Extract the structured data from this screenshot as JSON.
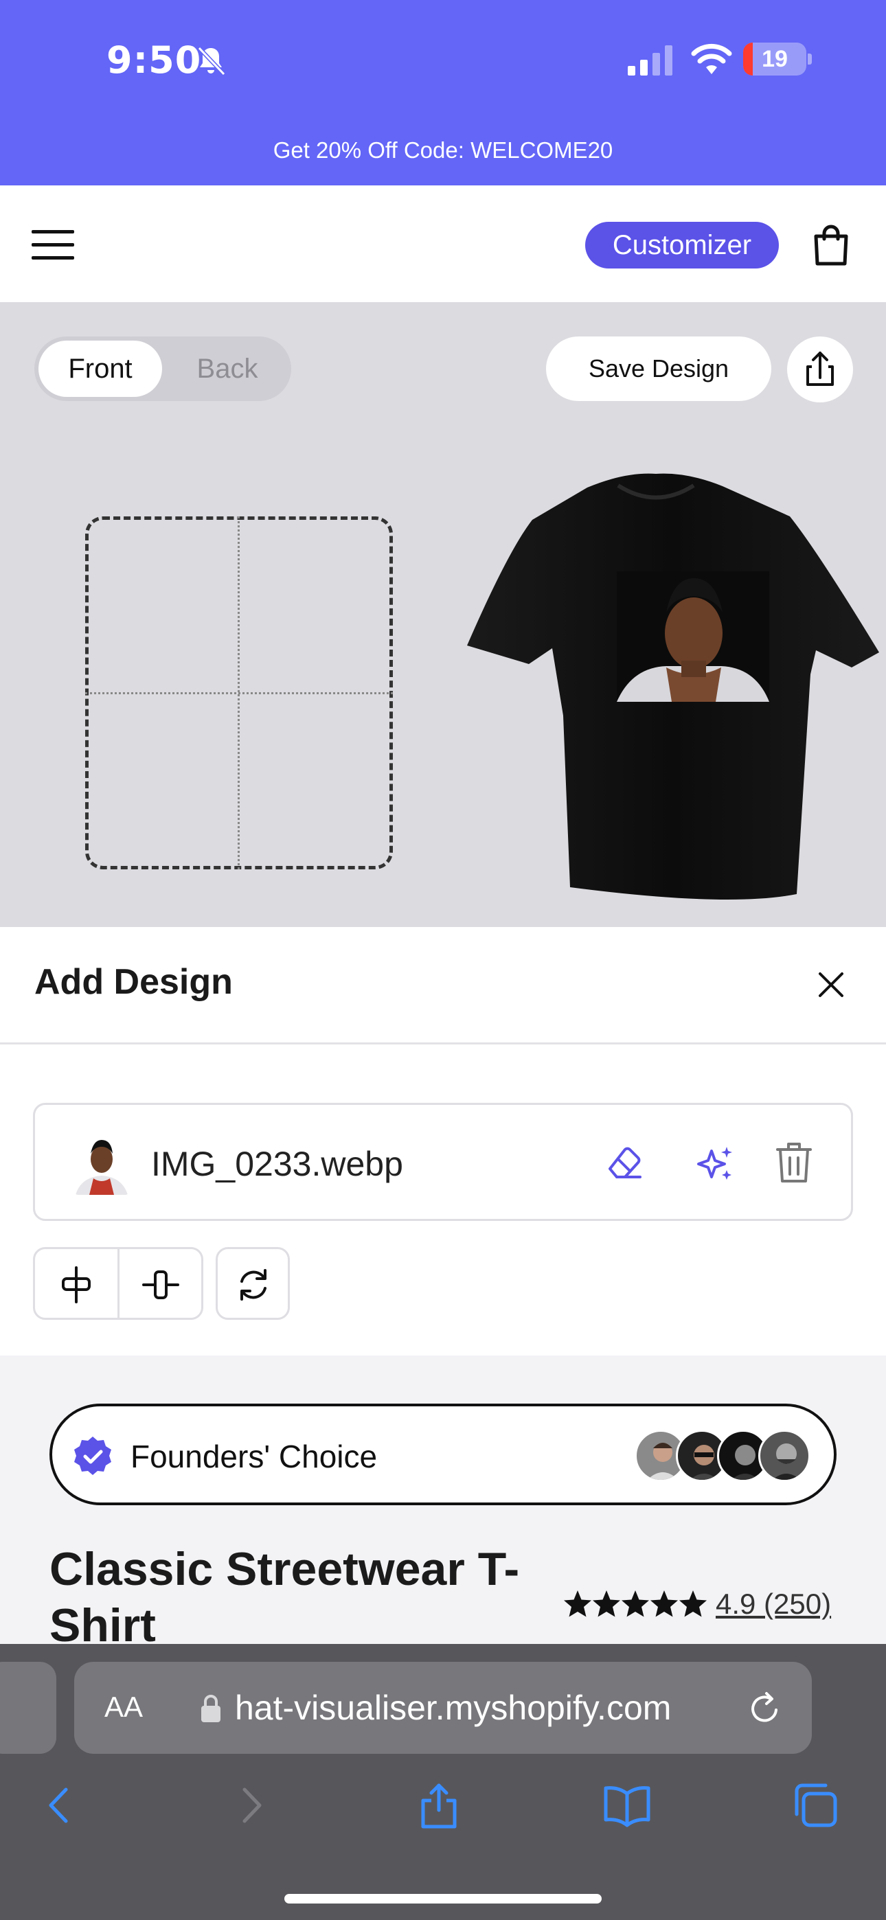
{
  "status_bar": {
    "time": "9:50",
    "battery": "19"
  },
  "promo": {
    "text": "Get 20% Off Code: WELCOME20"
  },
  "header": {
    "customizer_label": "Customizer"
  },
  "toolbar": {
    "front_label": "Front",
    "back_label": "Back",
    "save_label": "Save Design"
  },
  "sheet": {
    "title": "Add Design",
    "file_name": "IMG_0233.webp"
  },
  "product": {
    "badge_label": "Founders' Choice",
    "title": "Classic Streetwear T-Shirt",
    "rating": "4.9 (250)",
    "stars": 5
  },
  "browser": {
    "aa_label": "AA",
    "url": "hat-visualiser.myshopify.com"
  },
  "colors": {
    "brand": "#6366f6",
    "accent": "#5b52e8",
    "shirt": "#111111"
  }
}
